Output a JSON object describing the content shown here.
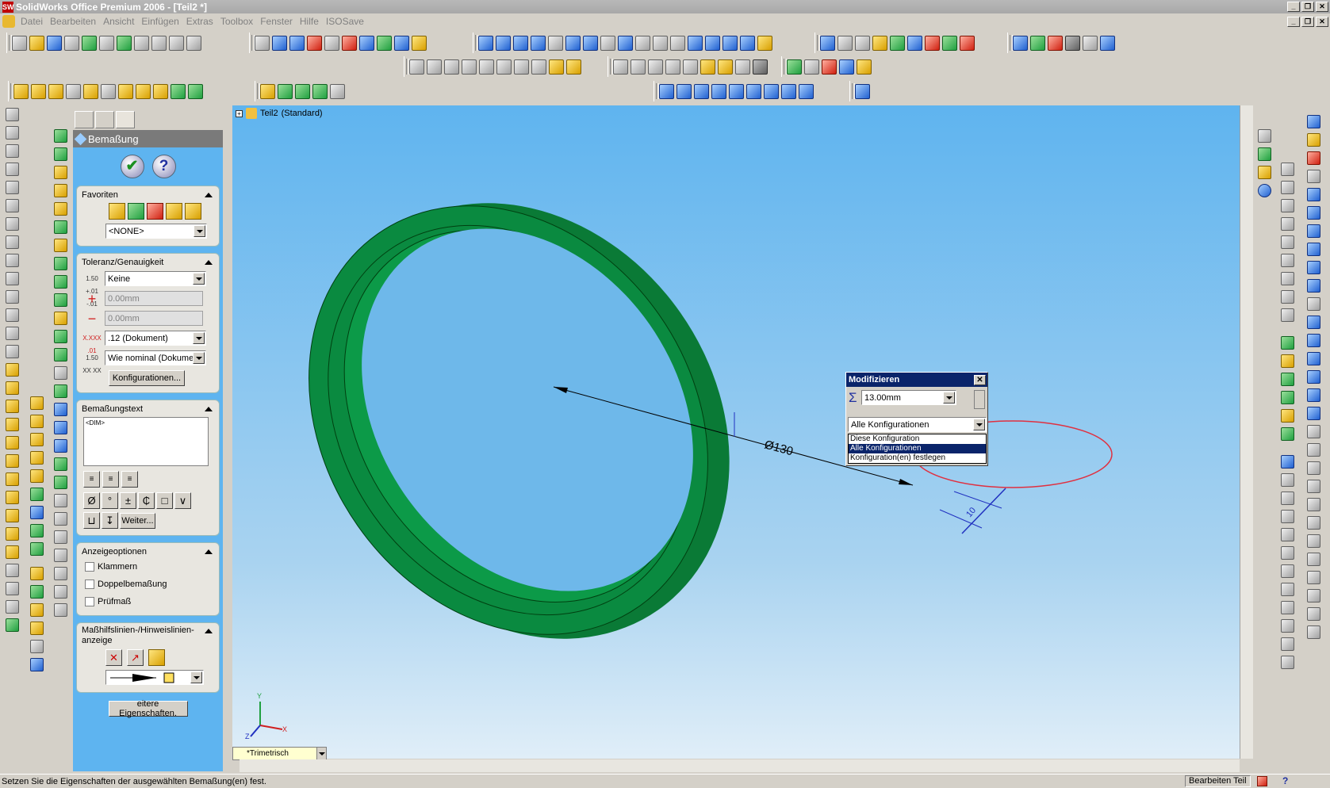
{
  "window": {
    "title": "SolidWorks Office Premium 2006 - [Teil2 *]",
    "app_icon_text": "SW",
    "buttons": [
      "_",
      "❐",
      "✕"
    ]
  },
  "menubar": {
    "items": [
      "Datei",
      "Bearbeiten",
      "Ansicht",
      "Einfügen",
      "Extras",
      "Toolbox",
      "Fenster",
      "Hilfe",
      "ISOSave"
    ],
    "doc_buttons": [
      "_",
      "❐",
      "✕"
    ]
  },
  "property_manager": {
    "title": "Bemaßung",
    "ok_label": "✔",
    "help_label": "?",
    "favoriten": {
      "title": "Favoriten",
      "selected": "<NONE>"
    },
    "toleranz": {
      "title": "Toleranz/Genauigkeit",
      "tolerance_icon": "1.50 +.01 -.01",
      "tolerance_type": "Keine",
      "plus_symbol": "+",
      "plus_placeholder": "0.00mm",
      "minus_symbol": "−",
      "minus_placeholder": "0.00mm",
      "precision_icon": "X.XXX .01",
      "precision": ".12 (Dokument)",
      "tol_precision_icon": "1.50 XX XX",
      "tolerance_precision": "Wie nominal (Dokumen",
      "konfig_button": "Konfigurationen..."
    },
    "text": {
      "title": "Bemaßungstext",
      "content": "<DIM>",
      "symbols": [
        "Ø",
        "°",
        "±",
        "₵",
        "□",
        "∨"
      ],
      "symbols2": [
        "⊔",
        "↧"
      ],
      "more_button": "Weiter..."
    },
    "anzeige": {
      "title": "Anzeigeoptionen",
      "options": [
        "Klammern",
        "Doppelbemaßung",
        "Prüfmaß"
      ]
    },
    "leader": {
      "title": "Maßhilfslinien-/Hinweislinien-anzeige"
    },
    "more_props_button": "eitere Eigenschaften."
  },
  "viewport": {
    "tree_label": "Teil2",
    "tree_config": "(Standard)",
    "expand_symbol": "+",
    "dimension_diameter": "Ø130",
    "dimension_width": "10",
    "view_orientation": "*Trimetrisch",
    "triad": {
      "x": "X",
      "y": "Y",
      "z": "Z"
    },
    "part_color": "#0a8a40"
  },
  "modify_dialog": {
    "title": "Modifizieren",
    "close": "✕",
    "sigma": "Σ",
    "value": "13.00mm",
    "config_selected": "Alle Konfigurationen",
    "options": [
      "Diese Konfiguration",
      "Alle Konfigurationen",
      "Konfiguration(en) festlegen"
    ],
    "selected_option_index": 1,
    "highlight_color": "#e03040"
  },
  "statusbar": {
    "message": "Setzen Sie die Eigenschaften der ausgewählten Bemaßung(en) fest.",
    "mode": "Bearbeiten Teil",
    "help_icon": "?"
  }
}
